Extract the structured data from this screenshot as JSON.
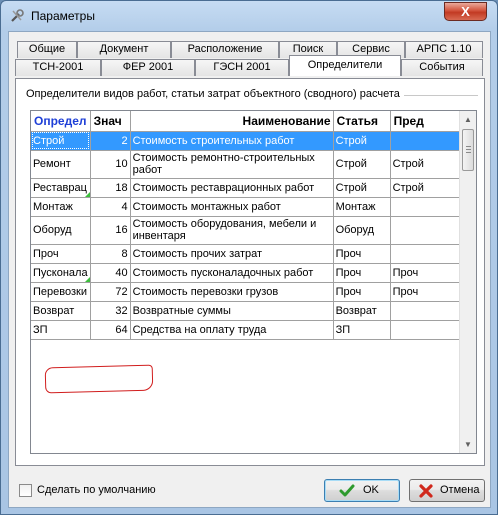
{
  "window": {
    "title": "Параметры",
    "close_glyph": "X"
  },
  "tabs_row1": [
    "Общие",
    "Документ",
    "Расположение",
    "Поиск",
    "Сервис",
    "АРПС 1.10"
  ],
  "tabs_row2": [
    "ТСН-2001",
    "ФЕР 2001",
    "ГЭСН 2001",
    "Определители",
    "События"
  ],
  "active_tab": "Определители",
  "group_caption": "Определители видов работ, статьи затрат объектного (сводного) расчета",
  "columns": [
    "Определ",
    "Знач",
    "Наименование",
    "Статья",
    "Пред"
  ],
  "rows": [
    {
      "code": "Строй",
      "value": "2",
      "name": "Стоимость строительных работ",
      "article": "Строй",
      "prev": "",
      "selected": true
    },
    {
      "code": "Ремонт",
      "value": "10",
      "name": "Стоимость ремонтно-строительных работ",
      "article": "Строй",
      "prev": "Строй"
    },
    {
      "code": "Реставрац",
      "value": "18",
      "name": "Стоимость реставрационных работ",
      "article": "Строй",
      "prev": "Строй"
    },
    {
      "code": "Монтаж",
      "value": "4",
      "name": "Стоимость монтажных работ",
      "article": "Монтаж",
      "prev": ""
    },
    {
      "code": "Оборуд",
      "value": "16",
      "name": "Стоимость оборудования, мебели и инвентаря",
      "article": "Оборуд",
      "prev": ""
    },
    {
      "code": "Проч",
      "value": "8",
      "name": "Стоимость прочих затрат",
      "article": "Проч",
      "prev": ""
    },
    {
      "code": "Пусконала",
      "value": "40",
      "name": "Стоимость пусконаладочных работ",
      "article": "Проч",
      "prev": "Проч"
    },
    {
      "code": "Перевозки",
      "value": "72",
      "name": "Стоимость перевозки грузов",
      "article": "Проч",
      "prev": "Проч"
    },
    {
      "code": "Возврат",
      "value": "32",
      "name": "Возвратные суммы",
      "article": "Возврат",
      "prev": ""
    },
    {
      "code": "ЗП",
      "value": "64",
      "name": "Средства на оплату труда",
      "article": "ЗП",
      "prev": ""
    }
  ],
  "checkbox_label": "Сделать по умолчанию",
  "checkbox_checked": false,
  "ok_label": "OK",
  "cancel_label": "Отмена",
  "colors": {
    "selection": "#3399ff",
    "header_active": "#1e3fd7",
    "annotation": "#d11e1e",
    "ok_icon": "#2e9a2e",
    "cancel_icon": "#d0281c"
  }
}
